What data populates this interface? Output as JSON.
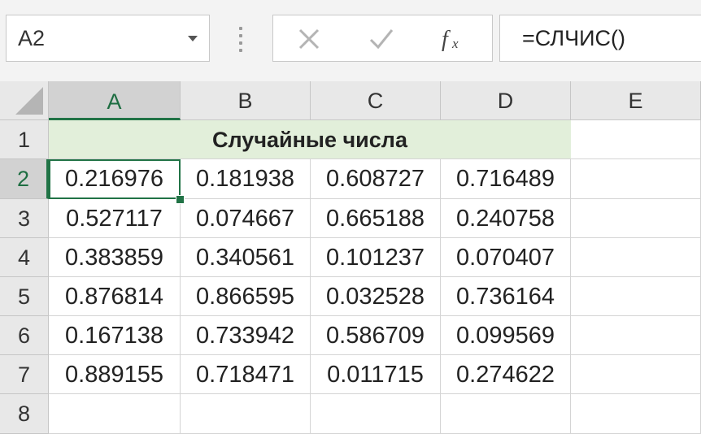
{
  "name_box": {
    "value": "A2"
  },
  "formula_bar": {
    "value": "=СЛЧИС()"
  },
  "icons": {
    "cancel": "cross-icon",
    "enter": "check-icon",
    "insert_function": "fx-icon"
  },
  "columns": [
    "A",
    "B",
    "C",
    "D",
    "E"
  ],
  "rows": [
    "1",
    "2",
    "3",
    "4",
    "5",
    "6",
    "7",
    "8"
  ],
  "selected_cell": {
    "column": "A",
    "row": "2"
  },
  "title": "Случайные числа",
  "data": [
    [
      "0.216976",
      "0.181938",
      "0.608727",
      "0.716489"
    ],
    [
      "0.527117",
      "0.074667",
      "0.665188",
      "0.240758"
    ],
    [
      "0.383859",
      "0.340561",
      "0.101237",
      "0.070407"
    ],
    [
      "0.876814",
      "0.866595",
      "0.032528",
      "0.736164"
    ],
    [
      "0.167138",
      "0.733942",
      "0.586709",
      "0.099569"
    ],
    [
      "0.889155",
      "0.718471",
      "0.011715",
      "0.274622"
    ]
  ],
  "colors": {
    "accent": "#217346",
    "header_bg": "#e8e8e8",
    "title_fill": "#e2efda"
  }
}
